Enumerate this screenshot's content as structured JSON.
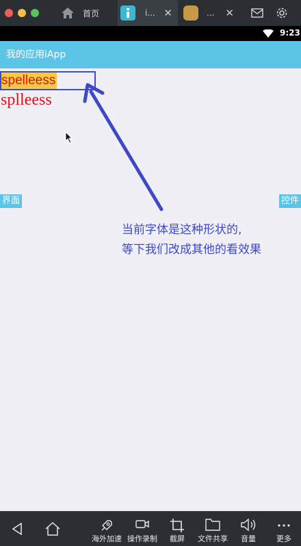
{
  "titlebar": {
    "tabs": [
      {
        "label": "首页",
        "icon": "home-icon"
      },
      {
        "label": "i...",
        "icon": "iapp-icon"
      },
      {
        "label": "...",
        "icon": "app-icon"
      }
    ],
    "right_icons": [
      "mail-icon",
      "gear-icon"
    ]
  },
  "statusbar": {
    "time": "9:23"
  },
  "appbar": {
    "title": "我的应用iApp"
  },
  "canvas": {
    "word1": "spelleess",
    "word2": "splleess",
    "left_button": "界面",
    "right_button": "控件",
    "annotation_line1": "当前字体是这种形状的,",
    "annotation_line2": "等下我们改成其他的看效果"
  },
  "navbar": {
    "items": [
      {
        "label": "海外加速",
        "icon": "rocket-icon"
      },
      {
        "label": "操作录制",
        "icon": "video-icon"
      },
      {
        "label": "截屏",
        "icon": "crop-icon"
      },
      {
        "label": "文件共享",
        "icon": "folder-icon"
      },
      {
        "label": "音量",
        "icon": "volume-icon"
      },
      {
        "label": "更多",
        "icon": "more-icon"
      }
    ]
  },
  "colors": {
    "accent": "#5bc5e8",
    "annotation": "#3d49c7",
    "text_red": "#d9161b",
    "highlight": "#f5c842"
  }
}
